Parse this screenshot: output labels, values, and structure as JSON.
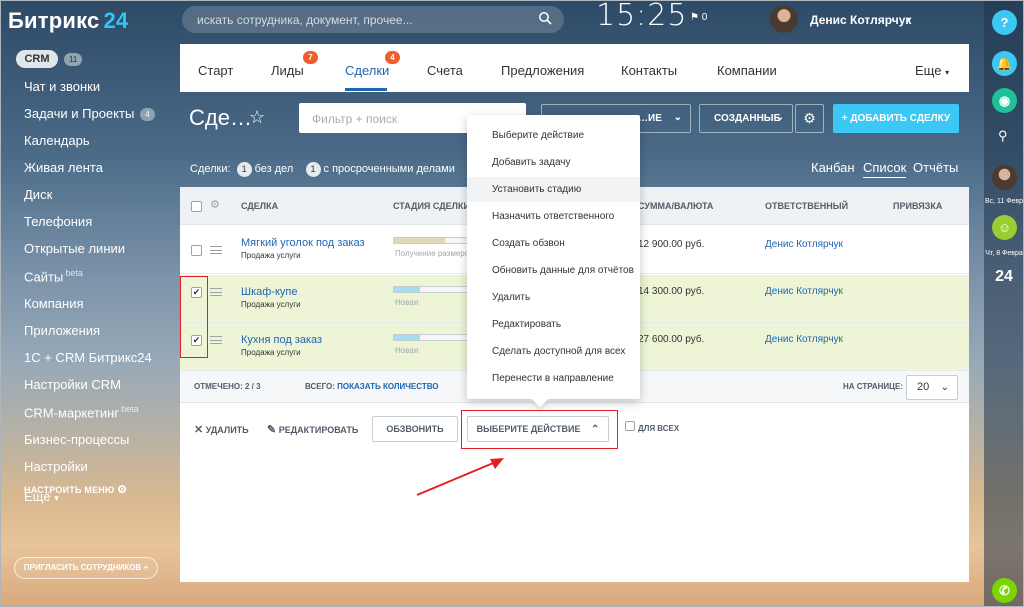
{
  "header": {
    "logo_text": "Битрикс",
    "logo_num": "24",
    "search_placeholder": "искать сотрудника, документ, прочее...",
    "clock": "15:25",
    "notifications": "0",
    "user_name": "Денис Котлярчук"
  },
  "sidebar": {
    "crm_label": "CRM",
    "crm_count": "11",
    "items": [
      {
        "label": "Чат и звонки"
      },
      {
        "label": "Задачи и Проекты",
        "badge": "4"
      },
      {
        "label": "Календарь"
      },
      {
        "label": "Живая лента"
      },
      {
        "label": "Диск"
      },
      {
        "label": "Телефония"
      },
      {
        "label": "Открытые линии"
      },
      {
        "label": "Сайты",
        "beta": "beta"
      },
      {
        "label": "Компания"
      },
      {
        "label": "Приложения"
      },
      {
        "label": "1С + CRM Битрикс24"
      },
      {
        "label": "Настройки CRM"
      },
      {
        "label": "CRM-маркетинг",
        "beta": "beta"
      },
      {
        "label": "Бизнес-процессы"
      },
      {
        "label": "Настройки"
      },
      {
        "label": "Ещё"
      }
    ],
    "setup_menu": "НАСТРОИТЬ МЕНЮ",
    "invite": "ПРИГЛАСИТЬ СОТРУДНИКОВ"
  },
  "rightbar": {
    "help": "?",
    "date1": "Вс, 11 Февр",
    "date2": "Чт, 8 Февра",
    "num": "24"
  },
  "tabs": [
    {
      "label": "Старт"
    },
    {
      "label": "Лиды",
      "badge": "7"
    },
    {
      "label": "Сделки",
      "badge": "4",
      "active": true
    },
    {
      "label": "Счета"
    },
    {
      "label": "Предложения"
    },
    {
      "label": "Контакты"
    },
    {
      "label": "Компании"
    },
    {
      "label": "Еще"
    }
  ],
  "toolbar": {
    "title": "Сде…",
    "filter_placeholder": "Фильтр + поиск",
    "select1": "…ИЕ",
    "select2": "СОЗДАННЫЕ",
    "add_button": "ДОБАВИТЬ СДЕЛКУ"
  },
  "counters": {
    "prefix": "Сделки:",
    "c1": "1",
    "c1_label": "без дел",
    "c2": "1",
    "c2_label": "с просроченными делами"
  },
  "views": [
    "Канбан",
    "Список",
    "Отчёты"
  ],
  "grid": {
    "headers": [
      "СДЕЛКА",
      "СТАДИЯ СДЕЛКИ",
      "СУММА/ВАЛЮТА",
      "ОТВЕТСТВЕННЫЙ",
      "ПРИВЯЗКА"
    ],
    "rows": [
      {
        "title": "Мягкий уголок под заказ",
        "subtitle": "Продажа услуги",
        "stage": "Получение размеров",
        "sum": "12 900.00 руб.",
        "responsible": "Денис Котлярчук",
        "checked": false,
        "stage_color": "#e0d7b6",
        "stage_fill": 0.7
      },
      {
        "title": "Шкаф-купе",
        "subtitle": "Продажа услуги",
        "stage": "Новая",
        "sum": "14 300.00 руб.",
        "responsible": "Денис Котлярчук",
        "checked": true,
        "stage_color": "#a6dcef",
        "stage_fill": 0.35
      },
      {
        "title": "Кухня под заказ",
        "subtitle": "Продажа услуги",
        "stage": "Новая",
        "sum": "27 600.00 руб.",
        "responsible": "Денис Котлярчук",
        "checked": true,
        "stage_color": "#a6dcef",
        "stage_fill": 0.35
      }
    ],
    "footer": {
      "marked": "ОТМЕЧЕНО: 2 / 3",
      "total_label": "ВСЕГО:",
      "total_link": "ПОКАЗАТЬ КОЛИЧЕСТВО",
      "per_page_label": "НА СТРАНИЦЕ:",
      "per_page": "20"
    }
  },
  "actions": {
    "delete": "УДАЛИТЬ",
    "edit": "РЕДАКТИРОВАТЬ",
    "call": "ОБЗВОНИТЬ",
    "choose": "ВЫБЕРИТЕ ДЕЙСТВИЕ",
    "for_all": "ДЛЯ ВСЕХ"
  },
  "popup": {
    "items": [
      "Выберите действие",
      "Добавить задачу",
      "Установить стадию",
      "Назначить ответственного",
      "Создать обзвон",
      "Обновить данные для отчётов",
      "Удалить",
      "Редактировать",
      "Сделать доступной для всех",
      "Перенести в направление"
    ],
    "hover_index": 2
  },
  "colors": {
    "accent": "#2067b0",
    "add_button": "#3bc8f5",
    "badge": "#f15e2c",
    "selected_row": "#edf5d6",
    "annotation": "#e41e26"
  }
}
